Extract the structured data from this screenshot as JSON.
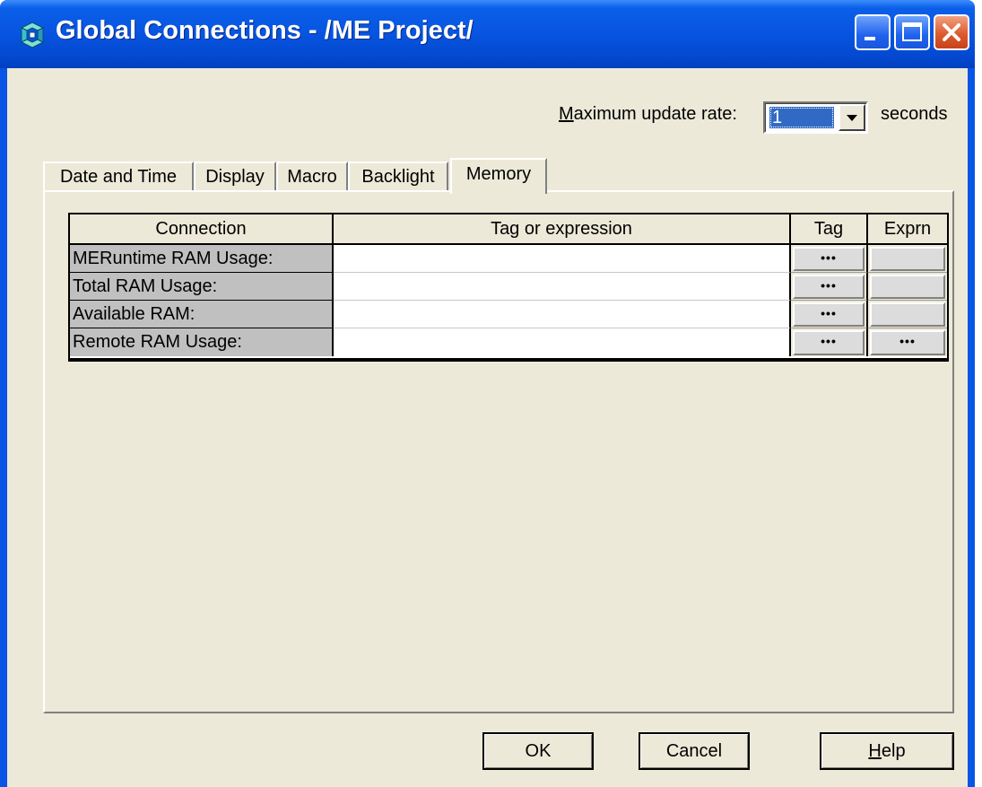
{
  "window": {
    "title": "Global Connections - /ME Project/"
  },
  "update_rate": {
    "label_accel": "M",
    "label_rest": "aximum update rate:",
    "value": "1",
    "units": "seconds"
  },
  "tabs": [
    {
      "label": "Date and Time"
    },
    {
      "label": "Display"
    },
    {
      "label": "Macro"
    },
    {
      "label": "Backlight"
    },
    {
      "label": "Memory",
      "active": true
    }
  ],
  "grid": {
    "headers": [
      "Connection",
      "Tag or expression",
      "Tag",
      "Exprn"
    ],
    "rows": [
      {
        "connection": "MERuntime RAM Usage:",
        "tag_button": "•••",
        "exprn_button": ""
      },
      {
        "connection": "Total RAM Usage:",
        "tag_button": "•••",
        "exprn_button": ""
      },
      {
        "connection": "Available RAM:",
        "tag_button": "•••",
        "exprn_button": ""
      },
      {
        "connection": "Remote RAM Usage:",
        "tag_button": "•••",
        "exprn_button": "•••"
      }
    ]
  },
  "buttons": {
    "ok": "OK",
    "cancel": "Cancel",
    "help_accel": "H",
    "help_rest": "elp"
  },
  "colors": {
    "titlebar": "#0754e0",
    "dialog_bg": "#ece9d8",
    "selection": "#316ac5",
    "close_button": "#dd5b2e"
  }
}
